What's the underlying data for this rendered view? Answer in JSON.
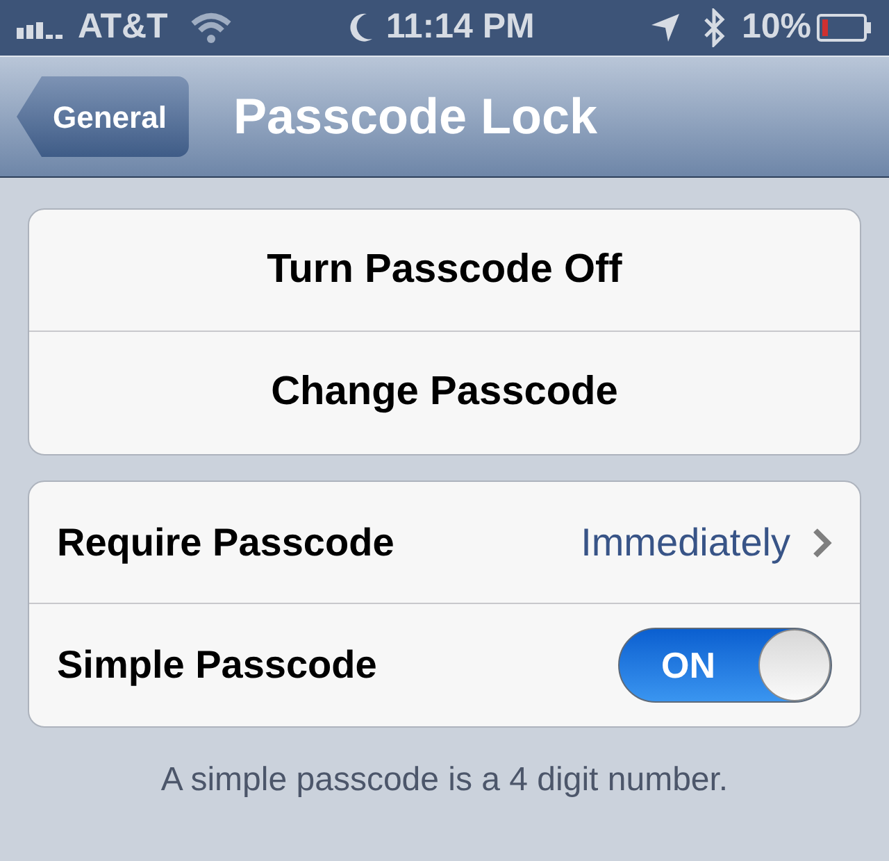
{
  "status_bar": {
    "carrier": "AT&T",
    "time": "11:14 PM",
    "battery": "10%"
  },
  "nav_bar": {
    "back": "General",
    "title": "Passcode Lock"
  },
  "groups": [
    {
      "rows": [
        {
          "kind": "action",
          "label": "Turn Passcode Off"
        },
        {
          "kind": "action",
          "label": "Change Passcode"
        }
      ]
    },
    {
      "rows": [
        {
          "kind": "disclosure",
          "label": "Require Passcode",
          "value": "Immediately"
        },
        {
          "kind": "switch",
          "label": "Simple Passcode",
          "on": true,
          "switch_label": "ON"
        }
      ],
      "footer": "A simple passcode is a 4 digit number."
    }
  ]
}
